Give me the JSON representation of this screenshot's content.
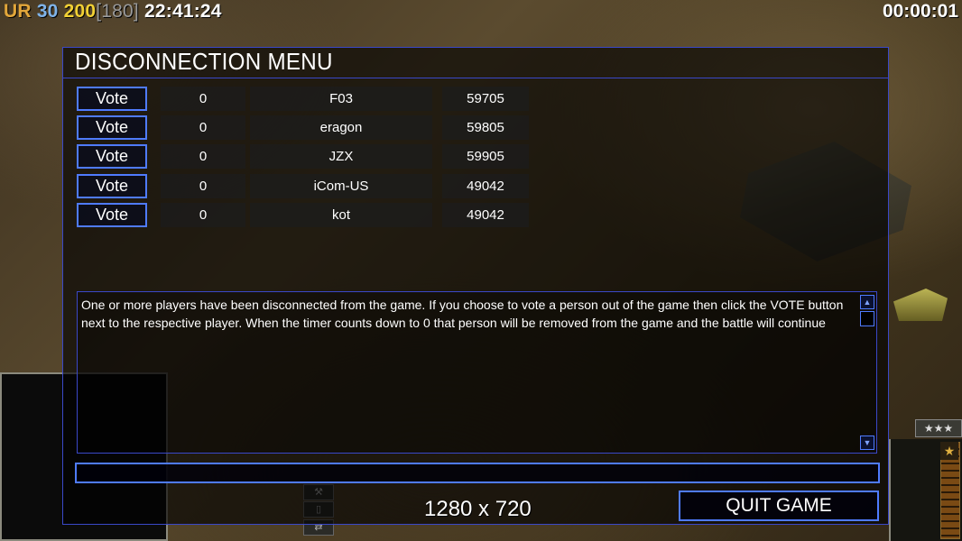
{
  "hud": {
    "prefix": "UR",
    "value1": "30",
    "value2": "200",
    "bracket": "[180]",
    "clock": "22:41:24",
    "timer": "00:00:01"
  },
  "dialog": {
    "title": "DISCONNECTION MENU",
    "players": [
      {
        "vote_label": "Vote",
        "votes": "0",
        "name": "F03",
        "id": "59705"
      },
      {
        "vote_label": "Vote",
        "votes": "0",
        "name": "eragon",
        "id": "59805"
      },
      {
        "vote_label": "Vote",
        "votes": "0",
        "name": "JZX",
        "id": "59905"
      },
      {
        "vote_label": "Vote",
        "votes": "0",
        "name": "iCom-US",
        "id": "49042"
      },
      {
        "vote_label": "Vote",
        "votes": "0",
        "name": "kot",
        "id": "49042"
      }
    ],
    "message": "One or more players have been disconnected from the game. If you choose to vote a person out of the game then click the VOTE button next to the respective player. When the timer counts down to 0 that person will be removed from the game and the battle will continue",
    "chat_value": "",
    "quit_label": "QUIT GAME"
  },
  "overlay": {
    "resolution": "1280 x 720"
  },
  "icons": {
    "scroll_up": "arrow-up-icon",
    "scroll_down": "arrow-down-icon",
    "rank": "rank-stars-icon",
    "power": "power-star-icon"
  },
  "colors": {
    "accent_border": "#4f7bff",
    "dialog_border": "#3a48c8",
    "hud_ur": "#e2a63a",
    "hud_value1": "#7fb3e8",
    "hud_value2": "#f1d034"
  }
}
